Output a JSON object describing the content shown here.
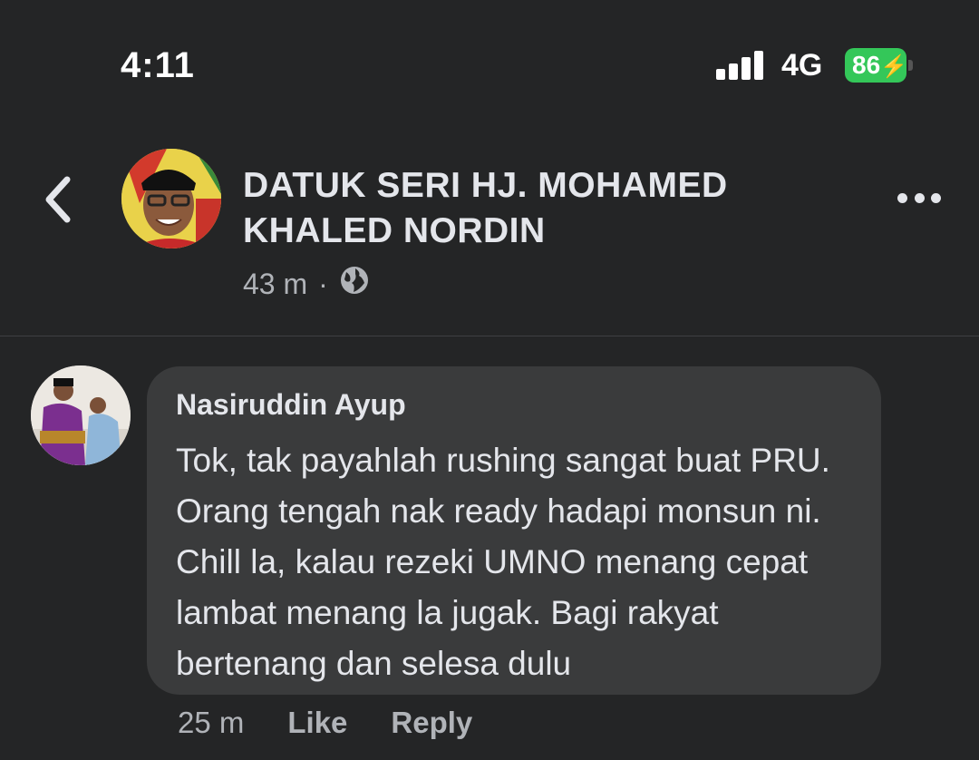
{
  "status_bar": {
    "time": "4:11",
    "network": "4G",
    "battery": "86"
  },
  "post_header": {
    "author": "DATUK SERI HJ. MOHAMED KHALED NORDIN",
    "time_ago": "43 m",
    "separator": "·",
    "privacy_icon": "globe-icon"
  },
  "comment": {
    "author": "Nasiruddin Ayup",
    "text": "Tok, tak payahlah rushing sangat buat PRU. Orang tengah nak ready hadapi monsun ni. Chill la, kalau rezeki UMNO menang cepat lambat menang la jugak. Bagi rakyat bertenang dan selesa dulu",
    "time_ago": "25 m",
    "like_label": "Like",
    "reply_label": "Reply"
  },
  "colors": {
    "background": "#242526",
    "bubble": "#3a3b3c",
    "battery": "#34c759",
    "secondary_text": "#b0b3b8"
  }
}
